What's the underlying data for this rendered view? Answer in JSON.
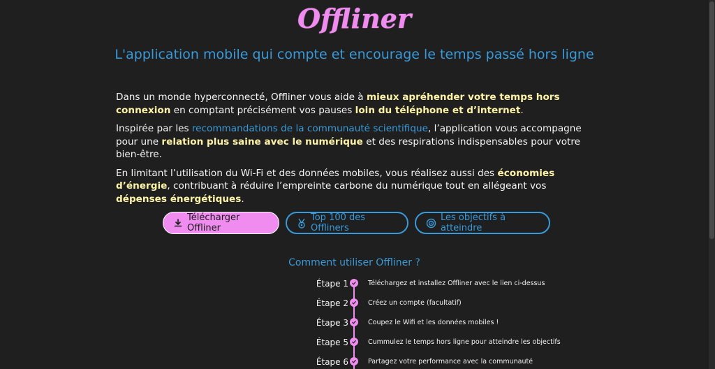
{
  "app": {
    "logo": "Offliner",
    "tagline": "L'application mobile qui compte et encourage le temps passé hors ligne"
  },
  "intro": {
    "p1": {
      "t1": "Dans un monde hyperconnecté, Offliner vous aide à ",
      "h1": "mieux apréhender votre temps hors connexion",
      "t2": " en comptant précisément vos pauses ",
      "h2": "loin du téléphone et d’internet",
      "t3": "."
    },
    "p2": {
      "t1": "Inspirée par les ",
      "link": "recommandations de la communauté scientifique",
      "t2": ", l’application vous accompagne pour une ",
      "h1": "relation plus saine avec le numérique",
      "t3": " et des respirations indispensables pour votre bien-être."
    },
    "p3": {
      "t1": "En limitant l’utilisation du Wi-Fi et des données mobiles, vous réalisez aussi des ",
      "h1": "économies d’énergie",
      "t2": ", contribuant à réduire l’empreinte carbone du numérique tout en allégeant vos ",
      "h2": "dépenses énergétiques",
      "t3": "."
    }
  },
  "buttons": {
    "download": "Télécharger Offliner",
    "top100": "Top 100 des Offliners",
    "goals": "Les objectifs à atteindre"
  },
  "howto": {
    "title": "Comment utiliser Offliner ?",
    "steps": [
      {
        "label": "Étape 1",
        "desc": "Téléchargez et installez Offliner avec le lien ci-dessus"
      },
      {
        "label": "Étape 2",
        "desc": "Créez un compte (facultatif)"
      },
      {
        "label": "Étape 3",
        "desc": "Coupez le Wifi et les données mobiles !"
      },
      {
        "label": "Étape 5",
        "desc": "Cummulez le temps hors ligne pour atteindre les objectifs"
      },
      {
        "label": "Étape 6",
        "desc": "Partagez votre performance avec la communauté"
      }
    ]
  },
  "colors": {
    "background": "#1f1f1f",
    "accent_pink": "#f08cf0",
    "accent_blue": "#3a9ad9",
    "highlight_yellow": "#fdf3a6"
  },
  "icons": {
    "download": "download-icon",
    "top100": "medal-icon",
    "goals": "target-icon",
    "step": "check-circle-icon"
  }
}
